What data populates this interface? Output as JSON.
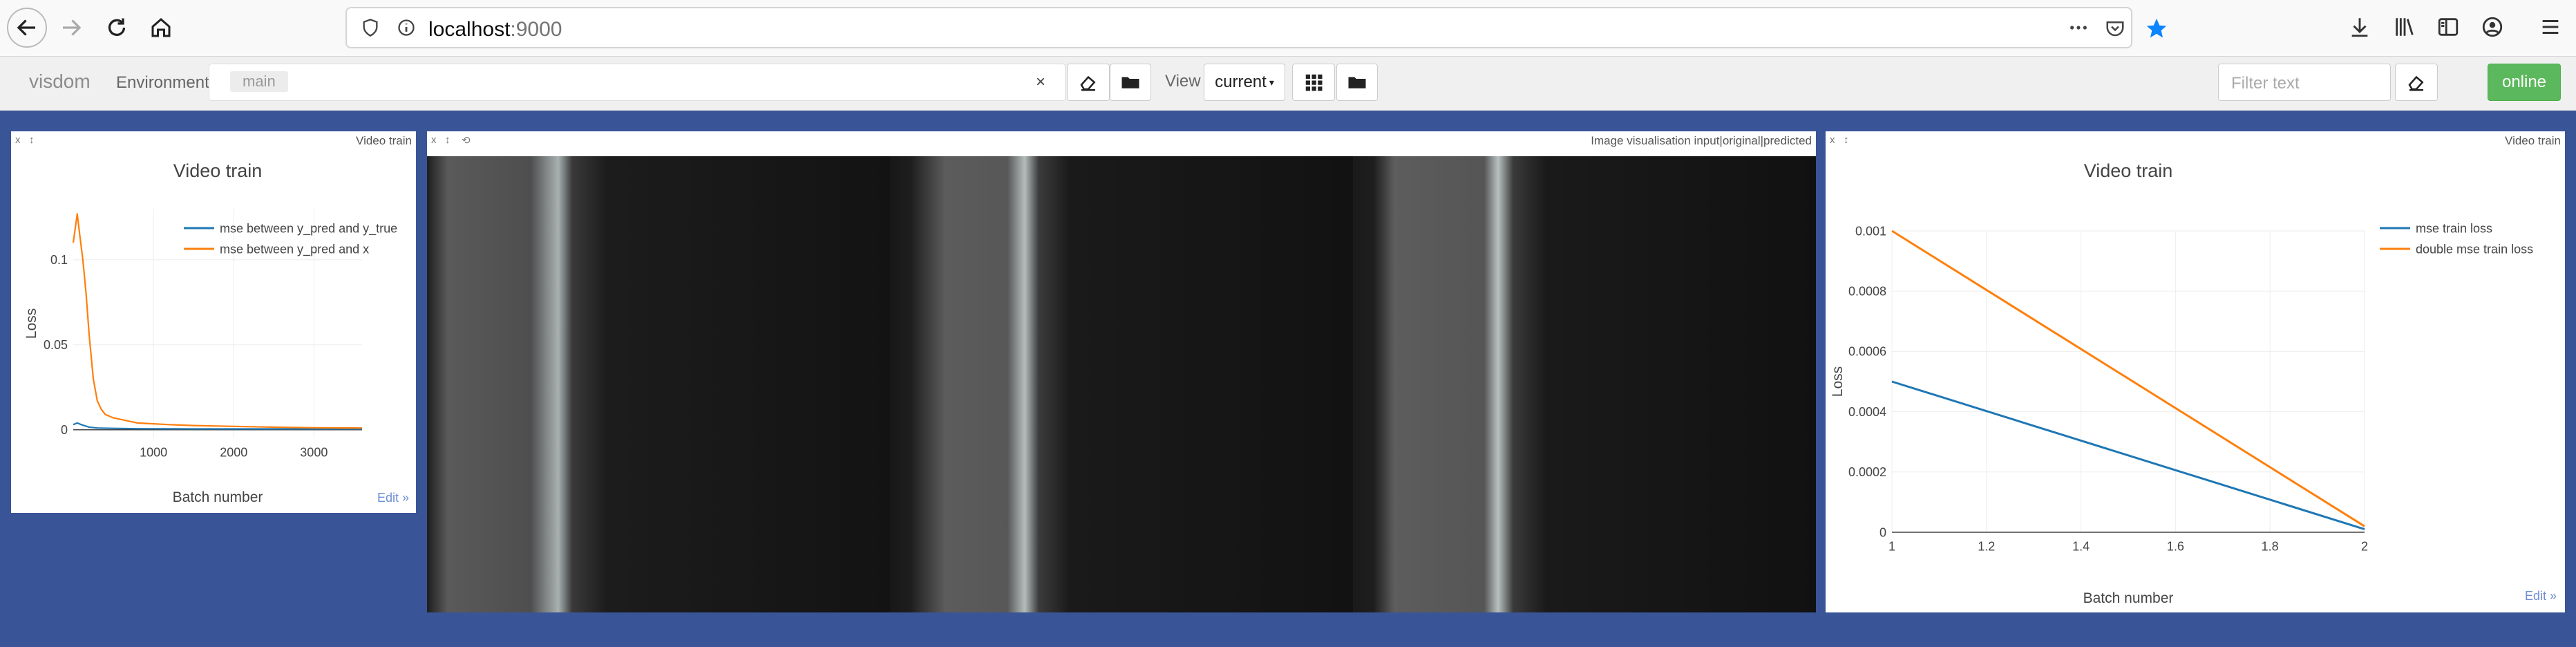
{
  "browser": {
    "url_host": "localhost",
    "url_port": ":9000"
  },
  "visdom": {
    "brand": "visdom",
    "environment_label": "Environment",
    "environment_value": "main",
    "clear_symbol": "×",
    "view_label": "View",
    "view_value": "current",
    "filter_placeholder": "Filter text",
    "status_button": "online"
  },
  "panes": [
    {
      "title": "Video train",
      "controls": [
        "x",
        "↕"
      ]
    },
    {
      "title": "Image visualisation input|original|predicted",
      "controls": [
        "x",
        "↕",
        "⟲"
      ]
    },
    {
      "title": "Video train",
      "controls": [
        "x",
        "↕"
      ]
    }
  ],
  "edit_label": "Edit »",
  "icons": [
    "back-arrow-icon",
    "forward-arrow-icon",
    "reload-icon",
    "home-icon",
    "shield-icon",
    "info-icon",
    "more-icon",
    "pocket-icon",
    "star-icon",
    "download-icon",
    "library-icon",
    "sidebar-icon",
    "account-icon",
    "menu-icon",
    "eraser-icon",
    "folder-icon",
    "grid-icon"
  ],
  "colors": {
    "accent_blue": "#1f77b4",
    "accent_orange": "#ff7f0e",
    "background": "#3a5597",
    "online_green": "#5cb85c"
  },
  "chart_data": [
    {
      "type": "line",
      "title": "Video train",
      "xlabel": "Batch number",
      "ylabel": "Loss",
      "xlim": [
        0,
        3600
      ],
      "ylim": [
        -0.005,
        0.13
      ],
      "x_ticks": [
        1000,
        2000,
        3000
      ],
      "x_tick_labels": [
        "1000",
        "2000",
        "3000"
      ],
      "y_ticks": [
        0,
        0.05,
        0.1
      ],
      "y_tick_labels": [
        "0",
        "0.05",
        "0.1"
      ],
      "legend_position": "top-right",
      "series": [
        {
          "name": "mse between y_pred and y_true",
          "color": "#1f77b4",
          "x": [
            0,
            50,
            100,
            200,
            300,
            500,
            800,
            1500,
            3600
          ],
          "y": [
            0.003,
            0.004,
            0.003,
            0.0015,
            0.001,
            0.0008,
            0.0006,
            0.0005,
            0.0005
          ]
        },
        {
          "name": "mse between y_pred and x",
          "color": "#ff7f0e",
          "x": [
            0,
            50,
            80,
            120,
            160,
            200,
            250,
            300,
            350,
            400,
            500,
            600,
            700,
            800,
            1000,
            1200,
            1500,
            2000,
            2500,
            3000,
            3600
          ],
          "y": [
            0.11,
            0.127,
            0.115,
            0.1,
            0.08,
            0.055,
            0.03,
            0.017,
            0.012,
            0.009,
            0.007,
            0.006,
            0.005,
            0.004,
            0.0035,
            0.003,
            0.0025,
            0.002,
            0.0015,
            0.0012,
            0.001
          ]
        }
      ]
    },
    {
      "type": "line",
      "title": "Video train",
      "xlabel": "Batch number",
      "ylabel": "Loss",
      "xlim": [
        1,
        2
      ],
      "ylim": [
        0,
        0.001
      ],
      "x_ticks": [
        1,
        1.2,
        1.4,
        1.6,
        1.8,
        2
      ],
      "x_tick_labels": [
        "1",
        "1.2",
        "1.4",
        "1.6",
        "1.8",
        "2"
      ],
      "y_ticks": [
        0,
        0.0002,
        0.0004,
        0.0006,
        0.0008,
        0.001
      ],
      "y_tick_labels": [
        "0",
        "0.0002",
        "0.0004",
        "0.0006",
        "0.0008",
        "0.001"
      ],
      "legend_position": "top-right",
      "series": [
        {
          "name": "mse train loss",
          "color": "#1f77b4",
          "x": [
            1,
            2
          ],
          "y": [
            0.0005,
            1e-05
          ]
        },
        {
          "name": "double mse train loss",
          "color": "#ff7f0e",
          "x": [
            1,
            2
          ],
          "y": [
            0.001,
            2e-05
          ]
        }
      ]
    }
  ]
}
